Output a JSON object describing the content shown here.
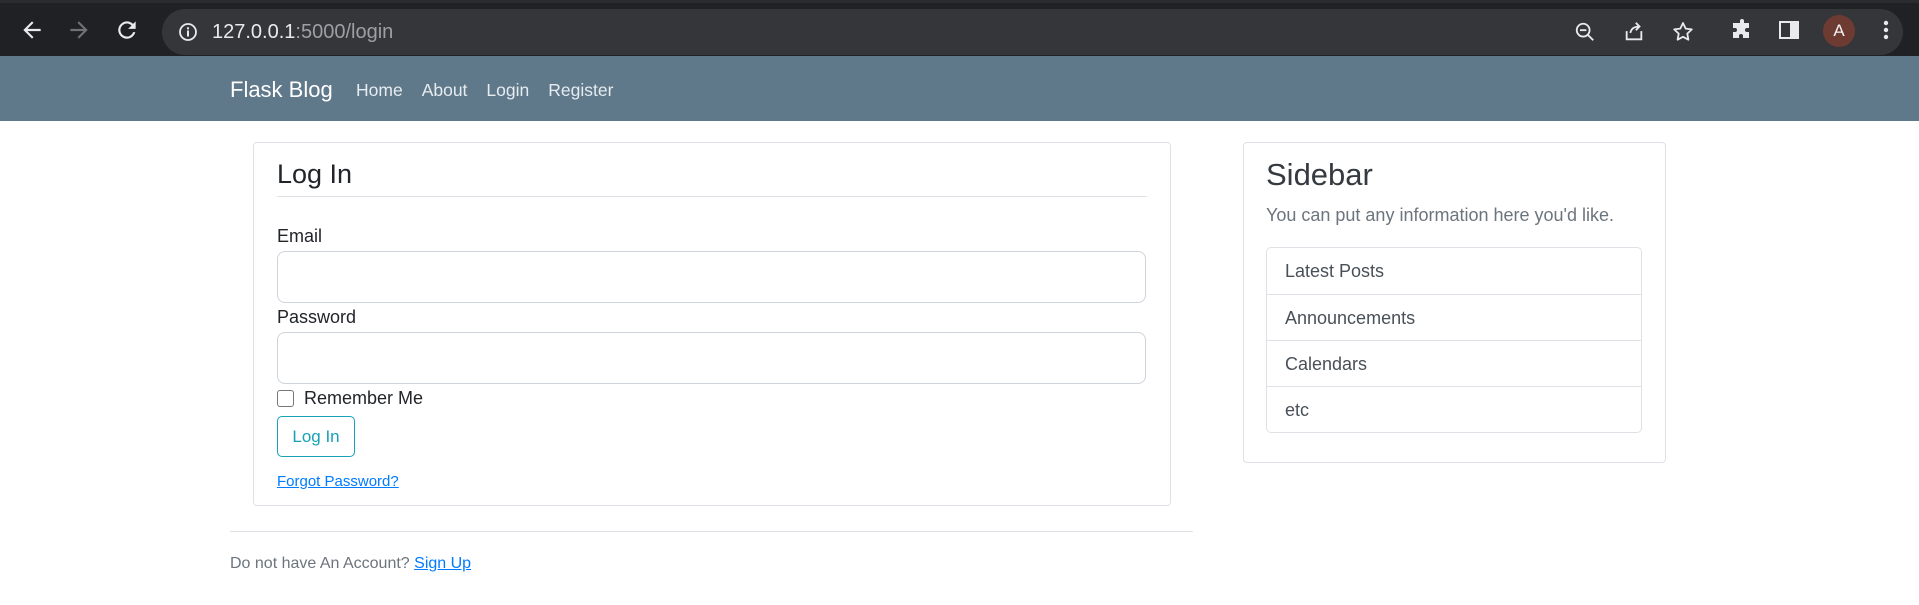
{
  "browser": {
    "url_host": "127.0.0.1",
    "url_rest": ":5000/login",
    "profile_initial": "A"
  },
  "site": {
    "brand": "Flask Blog",
    "nav": [
      "Home",
      "About",
      "Login",
      "Register"
    ]
  },
  "login": {
    "legend": "Log In",
    "email_label": "Email",
    "email_value": "",
    "password_label": "Password",
    "password_value": "",
    "remember_label": "Remember Me",
    "remember_checked": false,
    "submit_label": "Log In",
    "forgot_link": "Forgot Password?"
  },
  "footer": {
    "text": "Do not have An Account?",
    "signup_link": "Sign Up"
  },
  "sidebar": {
    "title": "Sidebar",
    "text": "You can put any information here you'd like.",
    "items": [
      "Latest Posts",
      "Announcements",
      "Calendars",
      "etc"
    ]
  },
  "colors": {
    "navbar": "#5f788a",
    "accent_button": "#17a2b8",
    "link": "#007bff"
  }
}
